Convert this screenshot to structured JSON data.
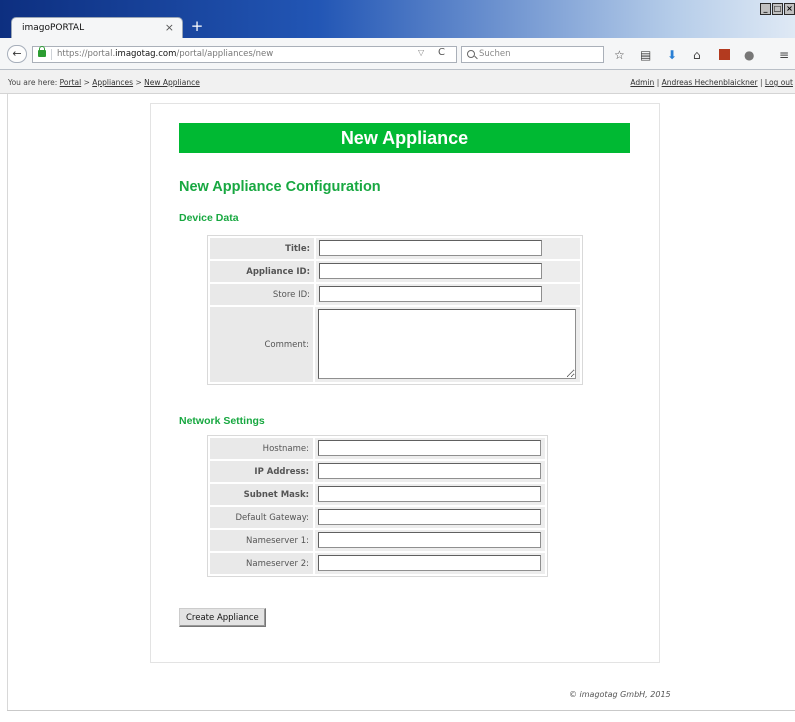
{
  "browser": {
    "tab_title": "imagoPORTAL",
    "tab_close": "×",
    "new_tab": "+",
    "window_controls": [
      "_",
      "□",
      "×"
    ],
    "back": "←",
    "url_prefix": "https://portal.",
    "url_domain": "imagotag.com",
    "url_path": "/portal/appliances/new",
    "dropdown": "▽",
    "reload": "C",
    "search_placeholder": "Suchen",
    "toolbar_icons": [
      "star-icon",
      "reading-list-icon",
      "download-icon",
      "home-icon",
      "addon-icon",
      "extension-icon",
      "menu-icon"
    ]
  },
  "breadcrumb": {
    "prefix": "You are here: ",
    "items": [
      "Portal",
      "Appliances",
      "New Appliance"
    ],
    "separator": " > "
  },
  "user": {
    "admin": "Admin",
    "name": "Andreas Hechenblaickner",
    "logout": "Log out",
    "separator": " | "
  },
  "page": {
    "title": "New Appliance",
    "subtitle": "New Appliance Configuration",
    "device_section": "Device Data",
    "network_section": "Network Settings",
    "submit": "Create Appliance",
    "footer": "© imagotag GmbH, 2015",
    "accent_color": "#00b933"
  },
  "device_fields": [
    {
      "label": "Title:",
      "value": "",
      "bold": true
    },
    {
      "label": "Appliance ID:",
      "value": "",
      "bold": true
    },
    {
      "label": "Store ID:",
      "value": "",
      "bold": false
    },
    {
      "label": "Comment:",
      "value": "",
      "bold": false
    }
  ],
  "network_fields": [
    {
      "label": "Hostname:",
      "value": "",
      "bold": false
    },
    {
      "label": "IP Address:",
      "value": "",
      "bold": true
    },
    {
      "label": "Subnet Mask:",
      "value": "",
      "bold": true
    },
    {
      "label": "Default Gateway:",
      "value": "",
      "bold": false
    },
    {
      "label": "Nameserver 1:",
      "value": "",
      "bold": false
    },
    {
      "label": "Nameserver 2:",
      "value": "",
      "bold": false
    }
  ]
}
